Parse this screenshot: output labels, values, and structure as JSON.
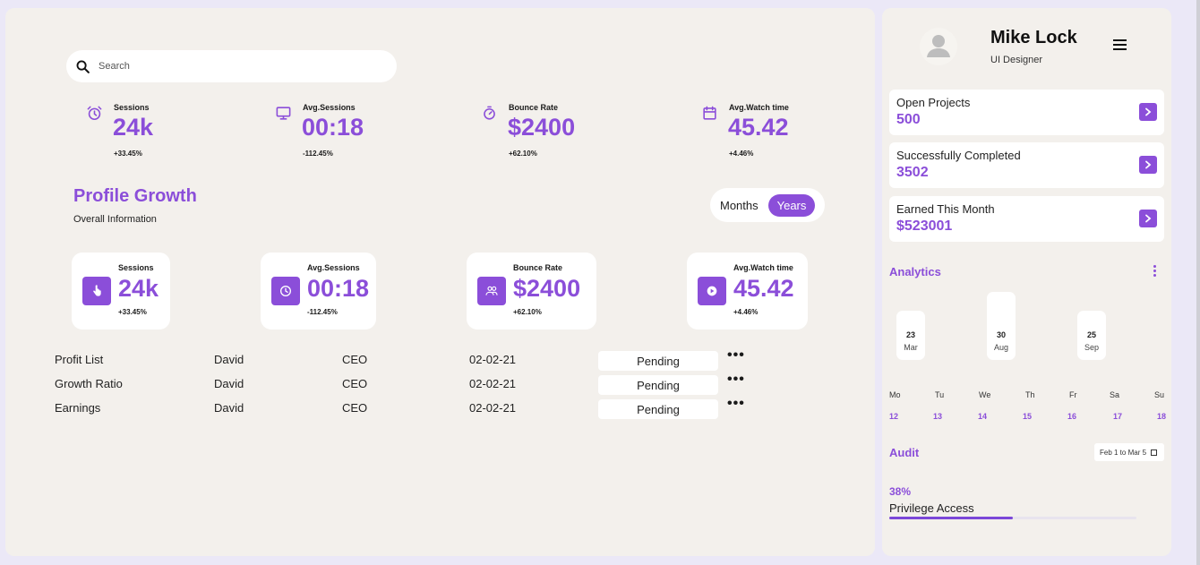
{
  "search": {
    "placeholder": "Search"
  },
  "top_stats": [
    {
      "label": "Sessions",
      "value": "24k",
      "change": "+33.45%",
      "icon": "alarm-clock-icon"
    },
    {
      "label": "Avg.Sessions",
      "value": "00:18",
      "change": "-112.45%",
      "icon": "monitor-icon"
    },
    {
      "label": "Bounce Rate",
      "value": "$2400",
      "change": "+62.10%",
      "icon": "timer-icon"
    },
    {
      "label": "Avg.Watch time",
      "value": "45.42",
      "change": "+4.46%",
      "icon": "calendar-icon"
    }
  ],
  "profile_growth": {
    "title": "Profile Growth",
    "subtitle": "Overall Information"
  },
  "toggle": {
    "months": "Months",
    "years": "Years",
    "active": "Years"
  },
  "cards": [
    {
      "label": "Sessions",
      "value": "24k",
      "change": "+33.45%",
      "icon": "touch-icon"
    },
    {
      "label": "Avg.Sessions",
      "value": "00:18",
      "change": "-112.45%",
      "icon": "clock-icon"
    },
    {
      "label": "Bounce Rate",
      "value": "$2400",
      "change": "+62.10%",
      "icon": "users-icon"
    },
    {
      "label": "Avg.Watch time",
      "value": "45.42",
      "change": "+4.46%",
      "icon": "play-icon"
    }
  ],
  "table": [
    {
      "name": "Profit List",
      "person": "David",
      "role": "CEO",
      "date": "02-02-21",
      "status": "Pending"
    },
    {
      "name": "Growth Ratio",
      "person": "David",
      "role": "CEO",
      "date": "02-02-21",
      "status": "Pending"
    },
    {
      "name": "Earnings",
      "person": "David",
      "role": "CEO",
      "date": "02-02-21",
      "status": "Pending"
    }
  ],
  "user": {
    "name": "Mike Lock",
    "role": "UI Designer"
  },
  "projects": [
    {
      "label": "Open Projects",
      "value": "500"
    },
    {
      "label": "Successfully Completed",
      "value": "3502"
    },
    {
      "label": "Earned This Month",
      "value": "$523001"
    }
  ],
  "analytics": {
    "title": "Analytics",
    "pills": [
      {
        "day": "23",
        "month": "Mar"
      },
      {
        "day": "30",
        "month": "Aug"
      },
      {
        "day": "25",
        "month": "Sep"
      }
    ],
    "weekdays": [
      "Mo",
      "Tu",
      "We",
      "Th",
      "Fr",
      "Sa",
      "Su"
    ],
    "dates": [
      "12",
      "13",
      "14",
      "15",
      "16",
      "17",
      "18"
    ]
  },
  "audit": {
    "title": "Audit",
    "range": "Feb 1 to Mar 5",
    "percent": "38%",
    "label": "Privilege Access",
    "progress": 0.5
  },
  "colors": {
    "accent": "#8b4ed9",
    "panel": "#f3f0ec",
    "background": "#ebe8f7"
  }
}
